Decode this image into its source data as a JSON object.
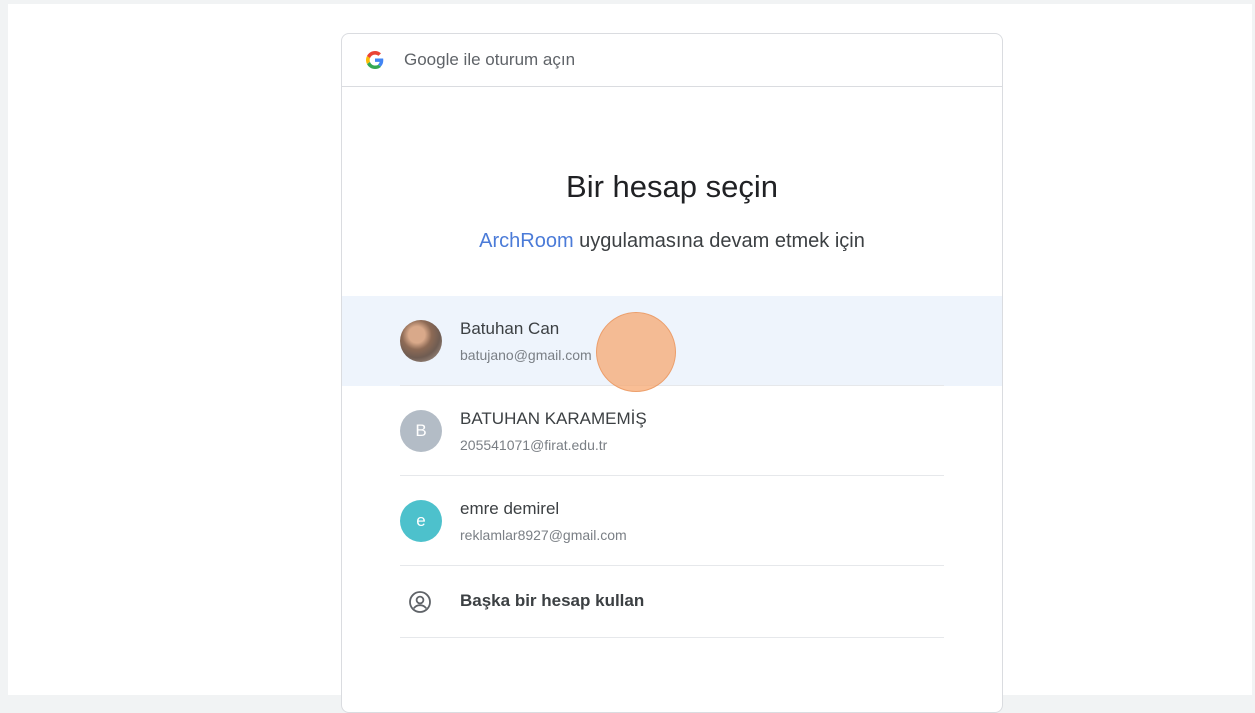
{
  "header": {
    "title": "Google ile oturum açın",
    "logo_icon": "google-g-icon"
  },
  "main": {
    "title": "Bir hesap seçin",
    "subtitle_app": "ArchRoom",
    "subtitle_rest": " uygulamasına devam etmek için",
    "app_link_color": "#4b7bd8"
  },
  "accounts": [
    {
      "name": "Batuhan Can",
      "email": "batujano@gmail.com",
      "avatar": "photo",
      "selected": true
    },
    {
      "name": "BATUHAN KARAMEMİŞ",
      "email": "205541071@firat.edu.tr",
      "avatar_letter": "B",
      "avatar_color": "#b3bcc6"
    },
    {
      "name": "emre demirel",
      "email": "reklamlar8927@gmail.com",
      "avatar_letter": "e",
      "avatar_color": "#4dc1cc"
    }
  ],
  "other_account": {
    "label": "Başka bir hesap kullan",
    "icon": "account-circle-icon"
  }
}
